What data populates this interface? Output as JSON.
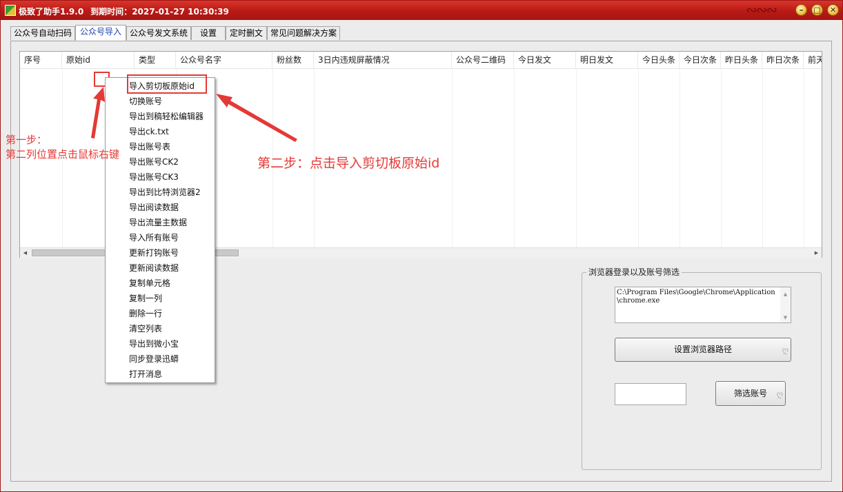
{
  "titlebar": {
    "app_name": "极致了助手1.9.0",
    "expiry_label": "到期时间：",
    "expiry_value": "2027-01-27 10:30:39"
  },
  "window_controls": {
    "minimize_icon": "minimize-icon",
    "maximize_icon": "maximize-icon",
    "close_icon": "close-icon"
  },
  "tabs": [
    {
      "label": "公众号自动扫码"
    },
    {
      "label": "公众号导入"
    },
    {
      "label": "公众号发文系统"
    },
    {
      "label": "设置"
    },
    {
      "label": "定时删文"
    },
    {
      "label": "常见问题解决方案"
    }
  ],
  "active_tab": "公众号导入",
  "grid": {
    "columns": [
      "序号",
      "原始id",
      "类型",
      "公众号名字",
      "粉丝数",
      "3日内违规屏蔽情况",
      "公众号二维码",
      "今日发文",
      "明日发文",
      "今日头条",
      "今日次条",
      "昨日头条",
      "昨日次条",
      "前天"
    ]
  },
  "context_menu": {
    "items": [
      "导入剪切板原始id",
      "切换账号",
      "导出到稿轻松编辑器",
      "导出ck.txt",
      "导出账号表",
      "导出账号CK2",
      "导出账号CK3",
      "导出到比特浏览器2",
      "导出阅读数据",
      "导出流量主数据",
      "导入所有账号",
      "更新打钩账号",
      "更新阅读数据",
      "复制单元格",
      "复制一列",
      "删除一行",
      "清空列表",
      "导出到微小宝",
      "同步登录迅蟒",
      "打开消息"
    ]
  },
  "annotations": {
    "step1_line1": "第一步：",
    "step1_line2": "第二列位置点击鼠标右键",
    "step2": "第二步：点击导入剪切板原始id",
    "color": "#e53935"
  },
  "browser_panel": {
    "title": "浏览器登录以及账号筛选",
    "browser_path": "C:\\Program Files\\Google\\Chrome\\Application\\chrome.exe",
    "set_path_button": "设置浏览器路径",
    "filter_value": "",
    "filter_button": "筛选账号"
  },
  "colors": {
    "titlebar": "#b81a16",
    "accent_red": "#e53935",
    "active_tab_text": "#1d3fb0"
  }
}
